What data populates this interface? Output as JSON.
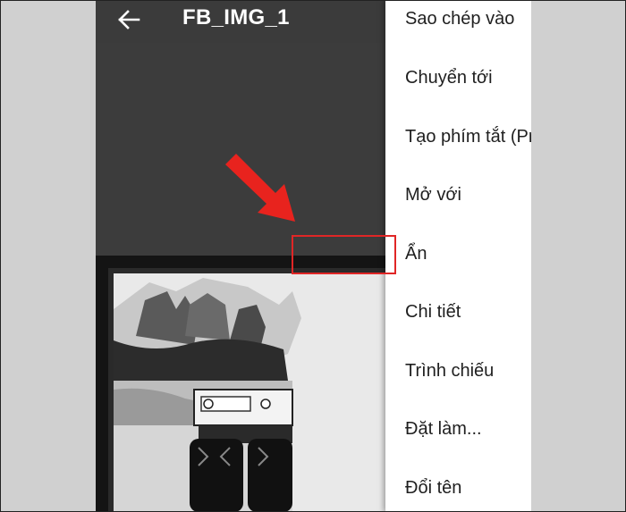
{
  "toolbar": {
    "title": "FB_IMG_1",
    "back_icon": "arrow-back-icon"
  },
  "menu": {
    "items": [
      {
        "label": "Sao chép vào"
      },
      {
        "label": "Chuyển tới"
      },
      {
        "label": "Tạo phím tắt (Pro)"
      },
      {
        "label": "Mở với"
      },
      {
        "label": "Ẩn"
      },
      {
        "label": "Chi tiết"
      },
      {
        "label": "Trình chiếu"
      },
      {
        "label": "Đặt làm..."
      },
      {
        "label": "Đổi tên"
      }
    ]
  },
  "annotation": {
    "highlight_color": "#e02626",
    "arrow_color": "#e8231e",
    "highlighted_item": "Ẩn"
  }
}
